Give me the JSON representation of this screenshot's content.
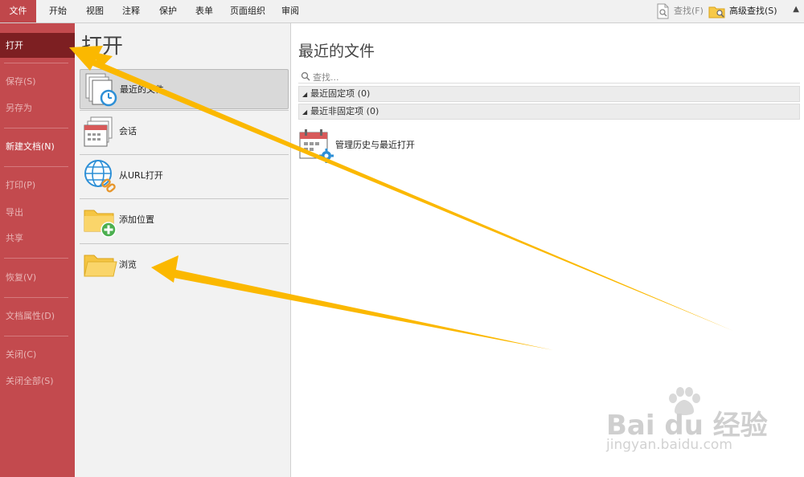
{
  "ribbon": {
    "tabs": [
      "文件",
      "开始",
      "视图",
      "注释",
      "保护",
      "表单",
      "页面组织",
      "审阅"
    ],
    "find_label": "查找(F)",
    "advanced_find_label": "高级查找(S)",
    "find_icon": "document-search-icon",
    "advanced_find_icon": "folder-search-icon"
  },
  "left_menu": {
    "items": [
      "打开",
      "保存(S)",
      "另存为",
      "新建文档(N)",
      "打印(P)",
      "导出",
      "共享",
      "恢复(V)",
      "文档属性(D)",
      "关闭(C)",
      "关闭全部(S)"
    ]
  },
  "middle": {
    "title": "打开",
    "options": [
      {
        "label": "最近的文件",
        "icon": "recent-files-clock-icon"
      },
      {
        "label": "会话",
        "icon": "session-calendar-icon"
      },
      {
        "label": "从URL打开",
        "icon": "globe-link-icon"
      },
      {
        "label": "添加位置",
        "icon": "folder-add-icon"
      },
      {
        "label": "浏览",
        "icon": "folder-open-icon"
      }
    ]
  },
  "right": {
    "title": "最近的文件",
    "search_placeholder": "查找...",
    "groups": [
      "最近固定项 (0)",
      "最近非固定项 (0)"
    ],
    "history_label": "管理历史与最近打开",
    "history_icon": "calendar-gear-icon"
  },
  "watermark": {
    "brand": "Bai du 经验",
    "url": "jingyan.baidu.com"
  },
  "colors": {
    "accent_red": "#c34a4e",
    "active_dark_red": "#7d1f22",
    "arrow_yellow": "#fbb800"
  }
}
